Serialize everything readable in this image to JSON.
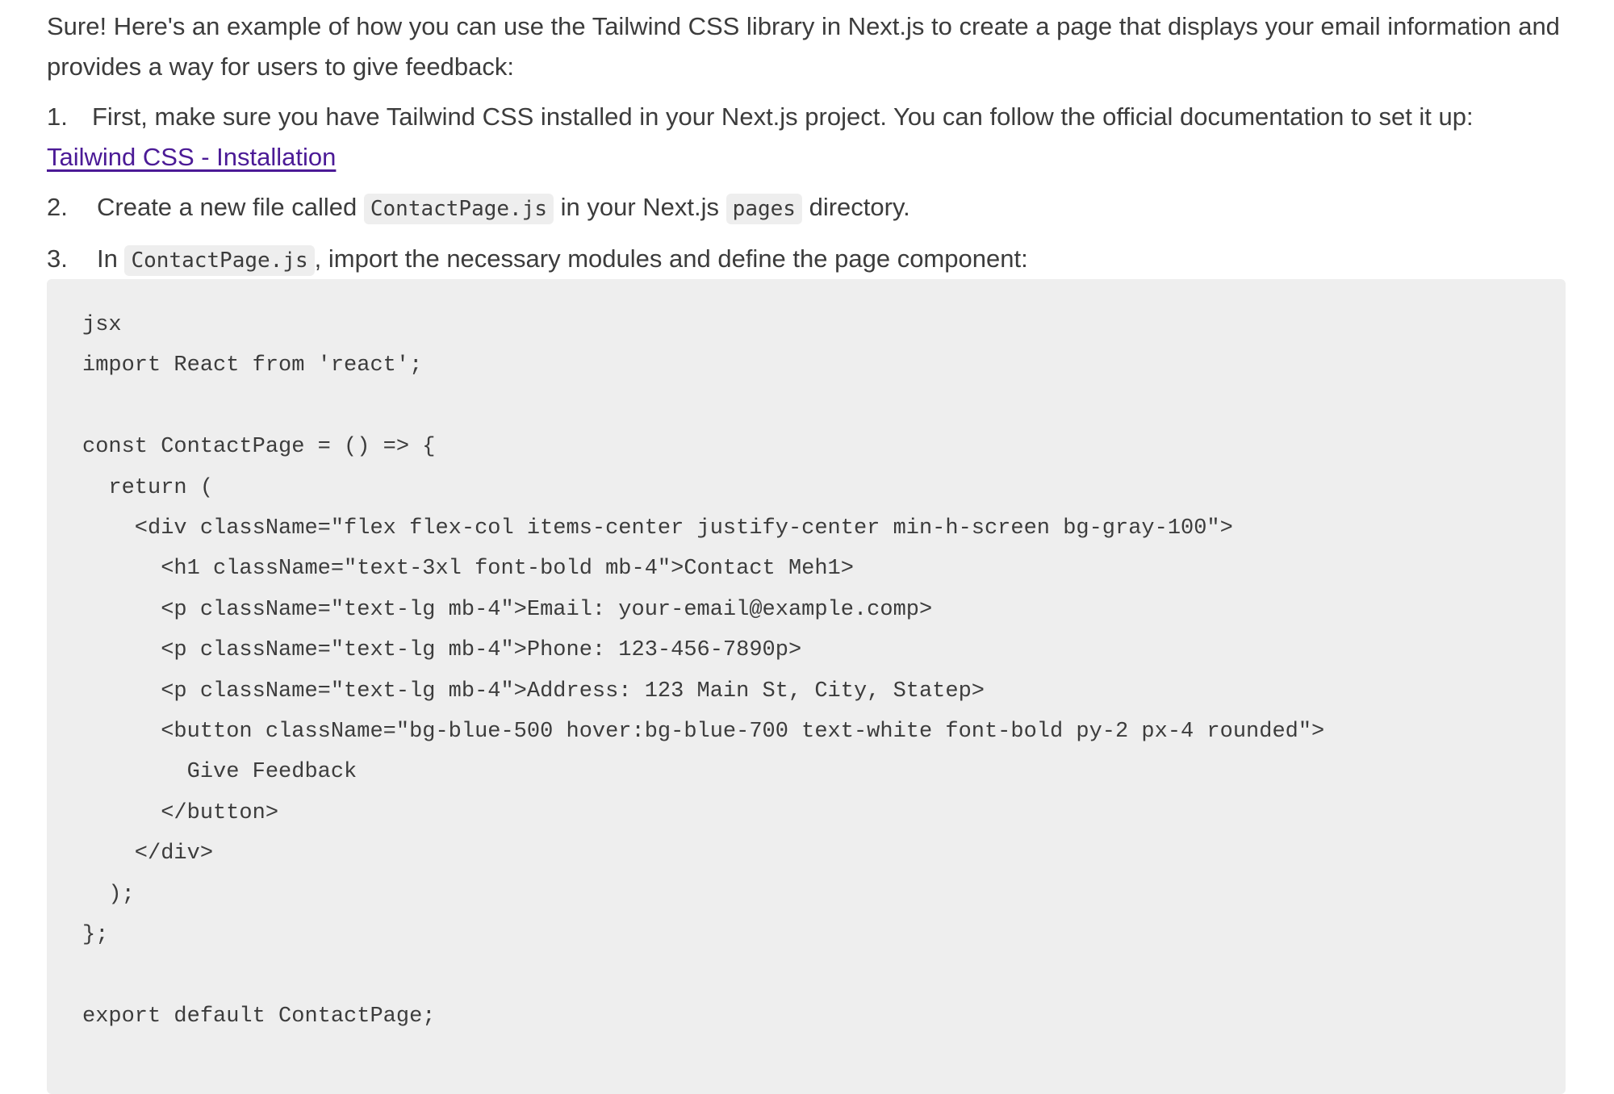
{
  "intro": "Sure! Here's an example of how you can use the Tailwind CSS library in Next.js to create a page that displays your email information and provides a way for users to give feedback:",
  "steps": [
    {
      "number": "1.",
      "text": "First, make sure you have Tailwind CSS installed in your Next.js project. You can follow the official documentation to set it up:",
      "link_text": "Tailwind CSS - Installation"
    },
    {
      "number": "2.",
      "before": "Create a new file called",
      "code1": "ContactPage.js",
      "middle": "in your Next.js",
      "code2": "pages",
      "after": "directory."
    },
    {
      "number": "3.",
      "before": "In",
      "code1": "ContactPage.js",
      "after": ", import the necessary modules and define the page component:"
    }
  ],
  "code_block": {
    "language": "jsx",
    "lines": [
      "import React from 'react';",
      "",
      "const ContactPage = () => {",
      "  return (",
      "    <div className=\"flex flex-col items-center justify-center min-h-screen bg-gray-100\">",
      "      <h1 className=\"text-3xl font-bold mb-4\">Contact Meh1>",
      "      <p className=\"text-lg mb-4\">Email: your-email@example.comp>",
      "      <p className=\"text-lg mb-4\">Phone: 123-456-7890p>",
      "      <p className=\"text-lg mb-4\">Address: 123 Main St, City, Statep>",
      "      <button className=\"bg-blue-500 hover:bg-blue-700 text-white font-bold py-2 px-4 rounded\">",
      "        Give Feedback",
      "      </button>",
      "    </div>",
      "  );",
      "};",
      "",
      "export default ContactPage;"
    ]
  },
  "colors": {
    "text": "#3c3c3c",
    "link": "#4b1a96",
    "code_background": "#eeeeee"
  }
}
